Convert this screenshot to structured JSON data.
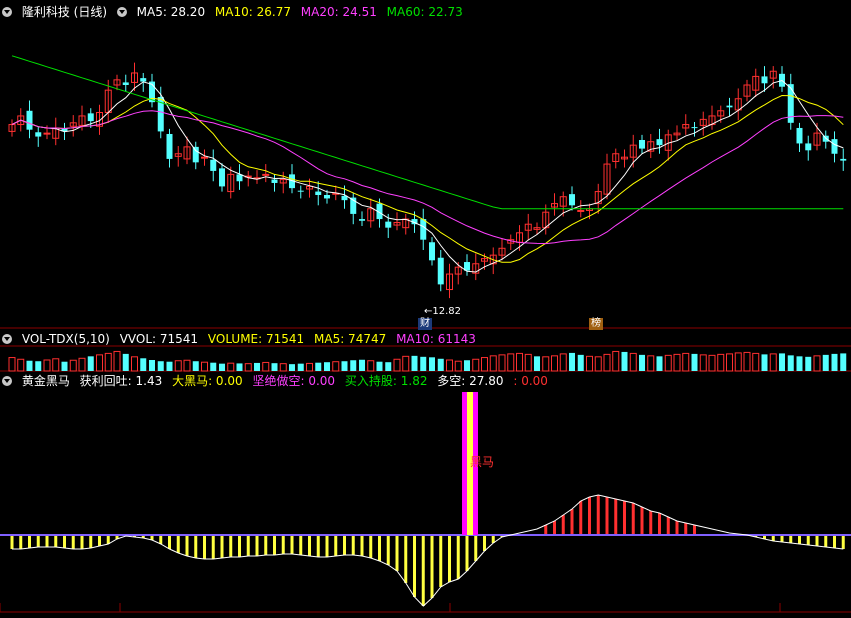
{
  "main_header": {
    "stock_label": "隆利科技 (日线)",
    "ma5": "MA5: 28.20",
    "ma10": "MA10: 26.77",
    "ma20": "MA20: 24.51",
    "ma60": "MA60: 22.73"
  },
  "vol_header": {
    "label": "VOL-TDX(5,10)",
    "vvol": "VVOL: 71541",
    "volume": "VOLUME: 71541",
    "ma5": "MA5: 74747",
    "ma10": "MA10: 61143"
  },
  "ind_header": {
    "name": "黄金黑马",
    "profit": "获利回吐: 1.43",
    "dark_horse": "大黑马: 0.00",
    "short": "坚绝做空: 0.00",
    "buy_hold": "买入持股: 1.82",
    "long_short": "多空: 27.80",
    "extra": ": 0.00"
  },
  "annotations": {
    "low_price": "←12.82",
    "cai_tag": "财",
    "bang_tag": "榜",
    "dark_horse_label": "黑马"
  },
  "colors": {
    "up": "#ff3030",
    "down": "#54ffff",
    "ma5": "#ffffff",
    "ma10": "#ffff00",
    "ma20": "#ff40ff",
    "ma60": "#00e000",
    "yellow": "#ffff40",
    "magenta": "#ff00ff"
  },
  "chart_data": [
    {
      "type": "candlestick",
      "title": "隆利科技 (日线)",
      "series_names": [
        "MA5",
        "MA10",
        "MA20",
        "MA60"
      ],
      "annotation_low": 12.82,
      "closes": [
        22.5,
        23.0,
        22.2,
        21.8,
        22.0,
        22.3,
        22.1,
        22.6,
        23.0,
        22.7,
        23.2,
        24.5,
        25.1,
        24.8,
        25.5,
        25.0,
        23.8,
        22.1,
        20.5,
        20.8,
        21.2,
        20.3,
        20.6,
        19.8,
        18.9,
        19.6,
        19.2,
        19.5,
        19.4,
        19.6,
        19.1,
        19.3,
        18.8,
        18.6,
        18.9,
        18.4,
        18.2,
        18.5,
        18.1,
        17.3,
        16.9,
        17.6,
        17.0,
        16.5,
        16.8,
        17.0,
        16.7,
        15.8,
        14.6,
        13.2,
        13.8,
        14.2,
        14.0,
        14.4,
        14.7,
        14.9,
        15.3,
        15.8,
        16.2,
        16.7,
        16.5,
        17.4,
        17.9,
        18.3,
        17.8,
        17.5,
        17.6,
        18.6,
        20.2,
        20.8,
        20.6,
        21.3,
        21.1,
        21.5,
        21.3,
        21.9,
        22.0,
        22.5,
        22.3,
        22.8,
        23.0,
        23.3,
        23.5,
        24.0,
        24.8,
        25.3,
        24.9,
        25.6,
        24.7,
        22.6,
        21.4,
        21.0,
        22.0,
        21.5,
        20.8,
        20.4
      ]
    },
    {
      "type": "bar",
      "title": "VOL-TDX(5,10)",
      "values": [
        55,
        48,
        42,
        40,
        45,
        50,
        38,
        44,
        52,
        60,
        66,
        72,
        80,
        70,
        58,
        52,
        45,
        40,
        38,
        42,
        44,
        40,
        36,
        34,
        30,
        32,
        31,
        30,
        33,
        35,
        32,
        30,
        28,
        30,
        31,
        34,
        36,
        38,
        40,
        44,
        46,
        42,
        38,
        36,
        48,
        60,
        62,
        58,
        56,
        50,
        45,
        40,
        44,
        48,
        55,
        62,
        66,
        70,
        72,
        68,
        60,
        58,
        62,
        70,
        74,
        66,
        60,
        58,
        68,
        80,
        78,
        72,
        66,
        62,
        60,
        64,
        68,
        72,
        70,
        66,
        64,
        68,
        70,
        74,
        76,
        72,
        68,
        70,
        72,
        64,
        60,
        58,
        62,
        66,
        70,
        72
      ]
    },
    {
      "type": "bar",
      "title": "黄金黑马",
      "series_names": [
        "获利回吐",
        "大黑马",
        "坚绝做空",
        "买入持股",
        "多空"
      ],
      "values": [
        -14,
        -14,
        -13,
        -12,
        -12,
        -12,
        -13,
        -14,
        -14,
        -13,
        -11,
        -9,
        -4,
        -1,
        -2,
        -3,
        -5,
        -9,
        -14,
        -18,
        -21,
        -23,
        -24,
        -24,
        -23,
        -22,
        -22,
        -21,
        -21,
        -20,
        -20,
        -19,
        -19,
        -20,
        -21,
        -22,
        -22,
        -21,
        -20,
        -20,
        -21,
        -23,
        -26,
        -30,
        -36,
        -48,
        -62,
        -71,
        -63,
        -52,
        -47,
        -44,
        -36,
        -26,
        -16,
        -8,
        -2,
        0,
        2,
        4,
        6,
        10,
        14,
        20,
        26,
        34,
        38,
        40,
        38,
        36,
        34,
        32,
        28,
        24,
        22,
        18,
        14,
        12,
        10,
        8,
        6,
        4,
        2,
        1,
        0,
        -2,
        -4,
        -6,
        -7,
        -8,
        -9,
        -10,
        -11,
        -12,
        -13,
        -14
      ],
      "dark_horse_signal_index": 48
    }
  ]
}
